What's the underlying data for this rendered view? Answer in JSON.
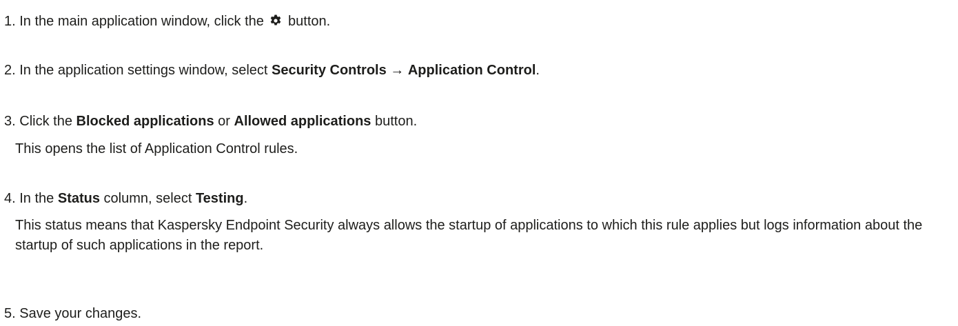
{
  "steps": [
    {
      "num": "1.",
      "text_before": "In the main application window, click the",
      "icon": "gear-icon",
      "text_after": "button."
    },
    {
      "num": "2.",
      "text_before": "In the application settings window, select",
      "bold_1": "Security Controls",
      "arrow": "→",
      "bold_2": "Application Control",
      "text_after": "."
    },
    {
      "num": "3.",
      "text_before": "Click the",
      "bold_1": "Blocked applications",
      "mid": "or",
      "bold_2": "Allowed applications",
      "text_after": "button.",
      "note": "This opens the list of Application Control rules."
    },
    {
      "num": "4.",
      "text_before": "In the",
      "bold_1": "Status",
      "mid": "column, select",
      "bold_2": "Testing",
      "text_after": ".",
      "note": "This status means that Kaspersky Endpoint Security always allows the startup of applications to which this rule applies but logs information about the startup of such applications in the report."
    },
    {
      "num": "5.",
      "text_before": "Save your changes."
    }
  ]
}
